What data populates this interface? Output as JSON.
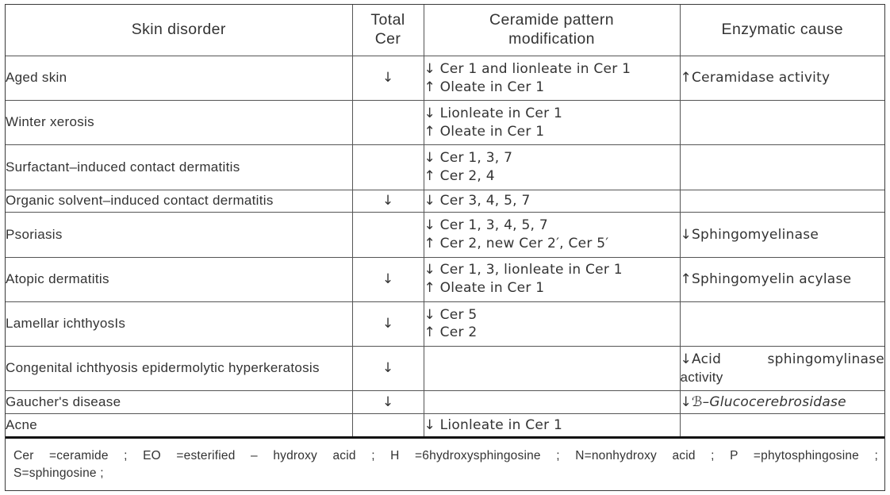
{
  "table": {
    "headers": [
      {
        "id": "skin-disorder",
        "lines": [
          "Skin disorder"
        ]
      },
      {
        "id": "total-cer",
        "lines": [
          "Total",
          "Cer"
        ]
      },
      {
        "id": "ceramide-pattern-modification",
        "lines": [
          "Ceramide pattern",
          "modification"
        ]
      },
      {
        "id": "enzymatic-cause",
        "lines": [
          "Enzymatic cause"
        ]
      }
    ],
    "rows": [
      {
        "disorder": "Aged skin",
        "total_cer": "↓",
        "pattern": [
          "↓ Cer 1 and lionleate in Cer 1",
          "↑ Oleate in Cer 1"
        ],
        "enzyme": [
          "↑Ceramidase activity"
        ]
      },
      {
        "disorder": "Winter xerosis",
        "total_cer": "",
        "pattern": [
          "↓ Lionleate in Cer 1",
          "↑ Oleate in Cer 1"
        ],
        "enzyme": []
      },
      {
        "disorder": "Surfactant–induced contact dermatitis",
        "total_cer": "",
        "pattern": [
          "↓ Cer 1, 3, 7",
          "↑ Cer 2, 4"
        ],
        "enzyme": []
      },
      {
        "disorder": "Organic solvent–induced contact dermatitis",
        "total_cer": "↓",
        "pattern": [
          "↓ Cer 3, 4, 5, 7"
        ],
        "enzyme": []
      },
      {
        "disorder": "Psoriasis",
        "total_cer": "",
        "pattern": [
          "↓ Cer 1, 3, 4, 5, 7",
          "↑ Cer 2, new Cer 2′, Cer 5′"
        ],
        "enzyme": [
          "↓Sphingomyelinase"
        ]
      },
      {
        "disorder": "Atopic dermatitis",
        "total_cer": "↓",
        "pattern": [
          "↓ Cer 1, 3, lionleate in Cer 1",
          "↑ Oleate in Cer 1"
        ],
        "enzyme": [
          "↑Sphingomyelin acylase"
        ]
      },
      {
        "disorder": "Lamellar ichthyosIs",
        "total_cer": "↓",
        "pattern": [
          "↓ Cer 5",
          "↑ Cer 2"
        ],
        "enzyme": []
      },
      {
        "disorder": "Congenital ichthyosis epidermolytic hyperkeratosis",
        "total_cer": "↓",
        "pattern": [],
        "enzyme": [
          "↓Acid sphingomylinase",
          "activity"
        ]
      },
      {
        "disorder": "Gaucher's disease",
        "total_cer": "↓",
        "pattern": [],
        "enzyme": [
          "↓ℬ–Glucocerebrosidase"
        ]
      },
      {
        "disorder": "Acne",
        "total_cer": "",
        "pattern": [
          "↓ Lionleate in Cer 1"
        ],
        "enzyme": []
      }
    ],
    "footnote": {
      "line1": "Cer =ceramide ; EO =esterified – hydroxy acid ; H =6hydroxysphingosine ; N=nonhydroxy acid ; P =phytosphingosine ;",
      "line2": "S=sphingosine ;"
    }
  }
}
